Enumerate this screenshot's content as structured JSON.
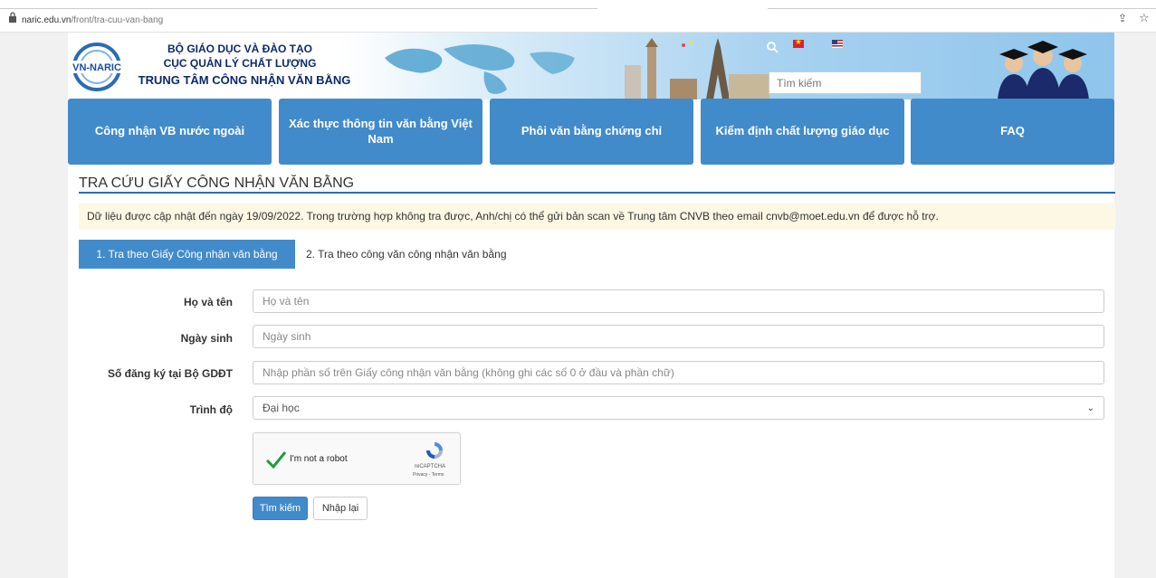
{
  "browser": {
    "url_domain": "naric.edu.vn",
    "url_path": "/front/tra-cuu-van-bang"
  },
  "header": {
    "logo_text": "VN-NARIC",
    "org_line1": "BỘ GIÁO DỤC VÀ ĐÀO TẠO",
    "org_line2": "CỤC QUẢN LÝ CHẤT LƯỢNG",
    "org_line3": "TRUNG TÂM CÔNG NHẬN VĂN BẰNG",
    "search_placeholder": "Tìm kiếm",
    "brand_color": "#0b2a6b"
  },
  "nav": {
    "items": [
      {
        "label": "Công nhận VB nước ngoài"
      },
      {
        "label": "Xác thực thông tin văn bằng Việt Nam"
      },
      {
        "label": "Phôi văn bằng chứng chỉ"
      },
      {
        "label": "Kiểm định chất lượng giáo dục"
      },
      {
        "label": "FAQ"
      }
    ],
    "color": "#428bca"
  },
  "main": {
    "title": "TRA CỨU GIẤY CÔNG NHẬN VĂN BẰNG",
    "notice": "Dữ liệu được cập nhật đến ngày 19/09/2022. Trong trường hợp không tra được, Anh/chị có thể gửi bản scan về Trung tâm CNVB theo email cnvb@moet.edu.vn để được hỗ trợ.",
    "tabs": [
      {
        "label": "1. Tra theo Giấy Công nhận văn bằng",
        "active": true
      },
      {
        "label": "2. Tra theo công văn công nhận văn bằng",
        "active": false
      }
    ],
    "form": {
      "name_label": "Họ và tên",
      "name_placeholder": "Họ và tên",
      "dob_label": "Ngày sinh",
      "dob_placeholder": "Ngày sinh",
      "reg_label": "Số đăng ký tại Bộ GDĐT",
      "reg_placeholder": "Nhập phần số trên Giấy công nhận văn bằng (không ghi các số 0 ở đầu và phần chữ)",
      "level_label": "Trình độ",
      "level_value": "Đại học"
    },
    "captcha": {
      "label": "I'm not a robot",
      "brand": "reCAPTCHA",
      "terms": "Privacy - Terms"
    },
    "buttons": {
      "search": "Tìm kiếm",
      "reset": "Nhập lại"
    }
  }
}
